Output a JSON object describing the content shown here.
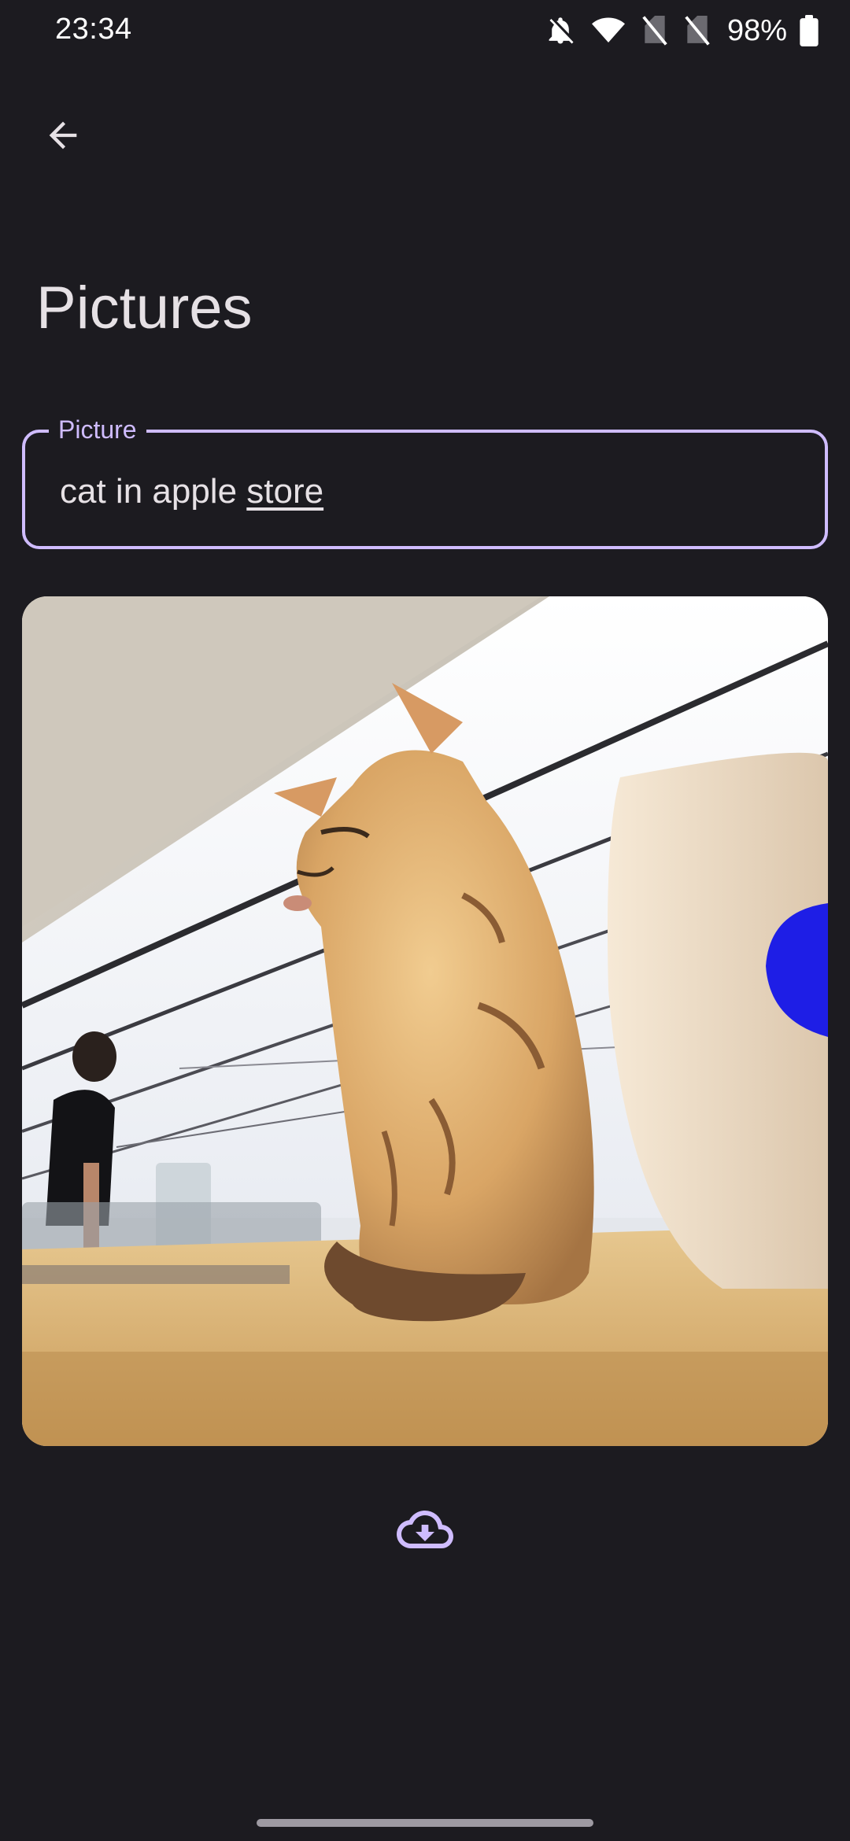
{
  "status_bar": {
    "time": "23:34",
    "battery": "98%",
    "icons": [
      "bell-off-icon",
      "wifi-icon",
      "no-sim-icon",
      "no-sim-icon",
      "battery-icon"
    ]
  },
  "nav": {
    "back_icon": "arrow-back-icon"
  },
  "page": {
    "title": "Pictures"
  },
  "picture_field": {
    "label": "Picture",
    "value_plain": "cat in apple ",
    "value_underlined": "store"
  },
  "image": {
    "subject": "cat-in-apple-store-photo"
  },
  "actions": {
    "download_icon": "cloud-download-icon"
  },
  "colors": {
    "background": "#1c1b20",
    "accent": "#cfbcff",
    "text": "#e6e1e5"
  }
}
